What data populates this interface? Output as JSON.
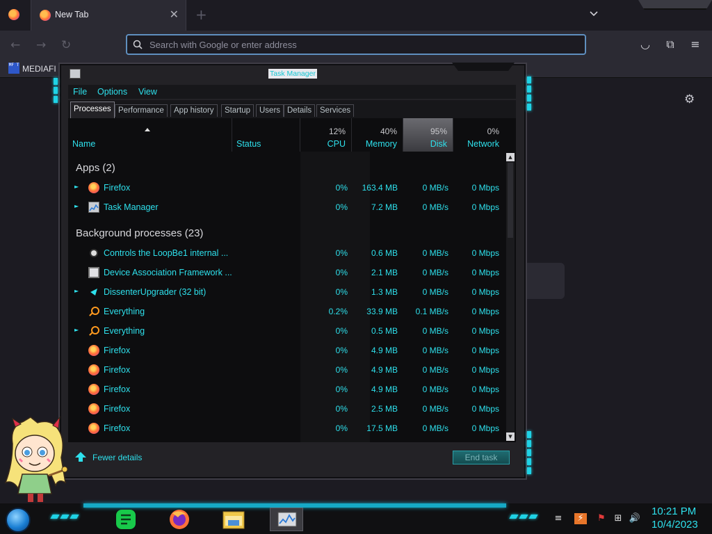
{
  "browser": {
    "tab_title": "New Tab",
    "url_placeholder": "Search with Google or enter address",
    "bookmark_label": "MEDIAFI",
    "bookmark_icon_text": "MF T"
  },
  "task_manager": {
    "title": "Task Manager",
    "menu": [
      "File",
      "Options",
      "View"
    ],
    "tabs": [
      "Processes",
      "Performance",
      "App history",
      "Startup",
      "Users",
      "Details",
      "Services"
    ],
    "active_tab": "Processes",
    "columns": {
      "name": "Name",
      "status": "Status",
      "cpu": {
        "pct": "12%",
        "label": "CPU"
      },
      "memory": {
        "pct": "40%",
        "label": "Memory"
      },
      "disk": {
        "pct": "95%",
        "label": "Disk"
      },
      "network": {
        "pct": "0%",
        "label": "Network"
      }
    },
    "groups": [
      {
        "title": "Apps (2)",
        "rows": [
          {
            "name": "Firefox",
            "icon": "firefox-icon",
            "expandable": true,
            "cpu": "0%",
            "mem": "163.4 MB",
            "disk": "0 MB/s",
            "net": "0 Mbps"
          },
          {
            "name": "Task Manager",
            "icon": "task-manager-icon",
            "expandable": true,
            "cpu": "0%",
            "mem": "7.2 MB",
            "disk": "0 MB/s",
            "net": "0 Mbps"
          }
        ]
      },
      {
        "title": "Background processes (23)",
        "rows": [
          {
            "name": "Controls the LoopBe1 internal ...",
            "icon": "loopbe-icon",
            "expandable": false,
            "cpu": "0%",
            "mem": "0.6 MB",
            "disk": "0 MB/s",
            "net": "0 Mbps"
          },
          {
            "name": "Device Association Framework ...",
            "icon": "device-icon",
            "expandable": false,
            "cpu": "0%",
            "mem": "2.1 MB",
            "disk": "0 MB/s",
            "net": "0 Mbps"
          },
          {
            "name": "DissenterUpgrader (32 bit)",
            "icon": "dissenter-icon",
            "expandable": true,
            "cpu": "0%",
            "mem": "1.3 MB",
            "disk": "0 MB/s",
            "net": "0 Mbps"
          },
          {
            "name": "Everything",
            "icon": "everything-icon",
            "expandable": false,
            "cpu": "0.2%",
            "mem": "33.9 MB",
            "disk": "0.1 MB/s",
            "net": "0 Mbps"
          },
          {
            "name": "Everything",
            "icon": "everything-icon",
            "expandable": true,
            "cpu": "0%",
            "mem": "0.5 MB",
            "disk": "0 MB/s",
            "net": "0 Mbps"
          },
          {
            "name": "Firefox",
            "icon": "firefox-icon",
            "expandable": false,
            "cpu": "0%",
            "mem": "4.9 MB",
            "disk": "0 MB/s",
            "net": "0 Mbps"
          },
          {
            "name": "Firefox",
            "icon": "firefox-icon",
            "expandable": false,
            "cpu": "0%",
            "mem": "4.9 MB",
            "disk": "0 MB/s",
            "net": "0 Mbps"
          },
          {
            "name": "Firefox",
            "icon": "firefox-icon",
            "expandable": false,
            "cpu": "0%",
            "mem": "4.9 MB",
            "disk": "0 MB/s",
            "net": "0 Mbps"
          },
          {
            "name": "Firefox",
            "icon": "firefox-icon",
            "expandable": false,
            "cpu": "0%",
            "mem": "2.5 MB",
            "disk": "0 MB/s",
            "net": "0 Mbps"
          },
          {
            "name": "Firefox",
            "icon": "firefox-icon",
            "expandable": false,
            "cpu": "0%",
            "mem": "17.5 MB",
            "disk": "0 MB/s",
            "net": "0 Mbps"
          }
        ]
      }
    ],
    "fewer_details_label": "Fewer details",
    "end_task_label": "End task"
  },
  "taskbar": {
    "apps": [
      "notes-app-icon",
      "firefox-icon",
      "file-explorer-icon",
      "task-manager-icon"
    ],
    "tray": [
      "show-desktop-icon",
      "tray-app-icon",
      "flag-icon",
      "network-icon",
      "volume-icon"
    ],
    "time": "10:21 PM",
    "date": "10/4/2023"
  },
  "colors": {
    "accent": "#2ee0ec",
    "window_bg": "#232226",
    "list_bg": "#0d0d0f",
    "browser_bg": "#1c1b22"
  }
}
